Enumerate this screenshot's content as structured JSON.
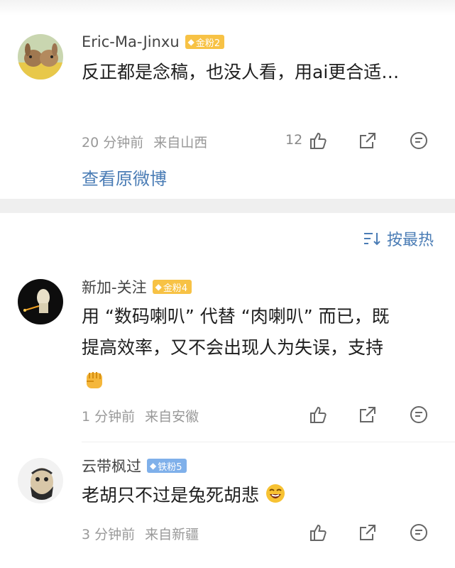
{
  "comments_top": {
    "user": "Eric-Ma-Jinxu",
    "badge": "金粉2",
    "text": "反正都是念稿，也没人看，用ai更合适…",
    "time": "20 分钟前",
    "source": "来自山西",
    "likes": "12",
    "view_original": "查看原微博"
  },
  "sort": {
    "label": "按最热"
  },
  "comments": [
    {
      "user": "新加-关注",
      "badge": "金粉4",
      "text_line1": "用 “数码喇叭” 代替 “肉喇叭” 而已，既",
      "text_line2": "提高效率，又不会出现人为失误，支持",
      "time": "1 分钟前",
      "source": "来自安徽"
    },
    {
      "user": "云带枫过",
      "badge": "铁粉5",
      "text": "老胡只不过是兔死胡悲",
      "time": "3 分钟前",
      "source": "来自新疆"
    }
  ],
  "colors": {
    "link": "#4a7cb5",
    "gold_badge": "#f7c245",
    "iron_badge": "#7fb0ea",
    "meta": "#999999"
  },
  "icons": [
    "like-icon",
    "share-icon",
    "reply-icon",
    "sort-icon",
    "fist-emoji-icon",
    "laugh-emoji-icon"
  ]
}
